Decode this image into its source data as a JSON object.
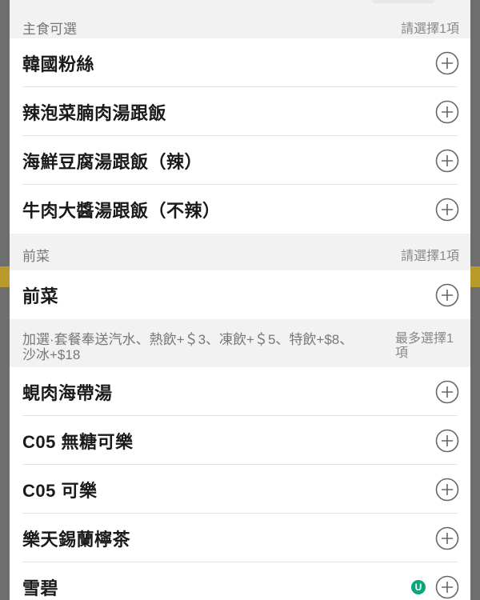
{
  "sections": [
    {
      "title": "主食可選",
      "hint": "請選擇1項",
      "items": [
        {
          "name": "韓國粉絲",
          "icon": "plus-circle-icon"
        },
        {
          "name": "辣泡菜腩肉湯跟飯",
          "icon": "plus-circle-icon"
        },
        {
          "name": "海鮮豆腐湯跟飯（辣）",
          "icon": "plus-circle-icon"
        },
        {
          "name": "牛肉大醬湯跟飯（不辣）",
          "icon": "plus-circle-icon"
        }
      ]
    },
    {
      "title": "前菜",
      "hint": "請選擇1項",
      "items": [
        {
          "name": "前菜",
          "icon": "plus-circle-icon"
        }
      ]
    },
    {
      "title": "加選·套餐奉送汽水、熱飲+＄3、凍飲+＄5、特飲+$8、沙冰+$18",
      "hint": "最多選擇1項",
      "items": [
        {
          "name": "蜆肉海帶湯",
          "icon": "plus-circle-icon"
        },
        {
          "name": "C05 無糖可樂",
          "icon": "plus-circle-icon"
        },
        {
          "name": "C05 可樂",
          "icon": "plus-circle-icon"
        },
        {
          "name": "樂天錫蘭檸茶",
          "icon": "plus-circle-icon"
        },
        {
          "name": "雪碧",
          "icon": "plus-circle-icon"
        }
      ]
    }
  ],
  "colors": {
    "accent": "#b79a2a",
    "header_bg": "#f2f2f2",
    "text": "#1a1a1a",
    "muted": "#777777",
    "watermark": "#0aa67a"
  }
}
